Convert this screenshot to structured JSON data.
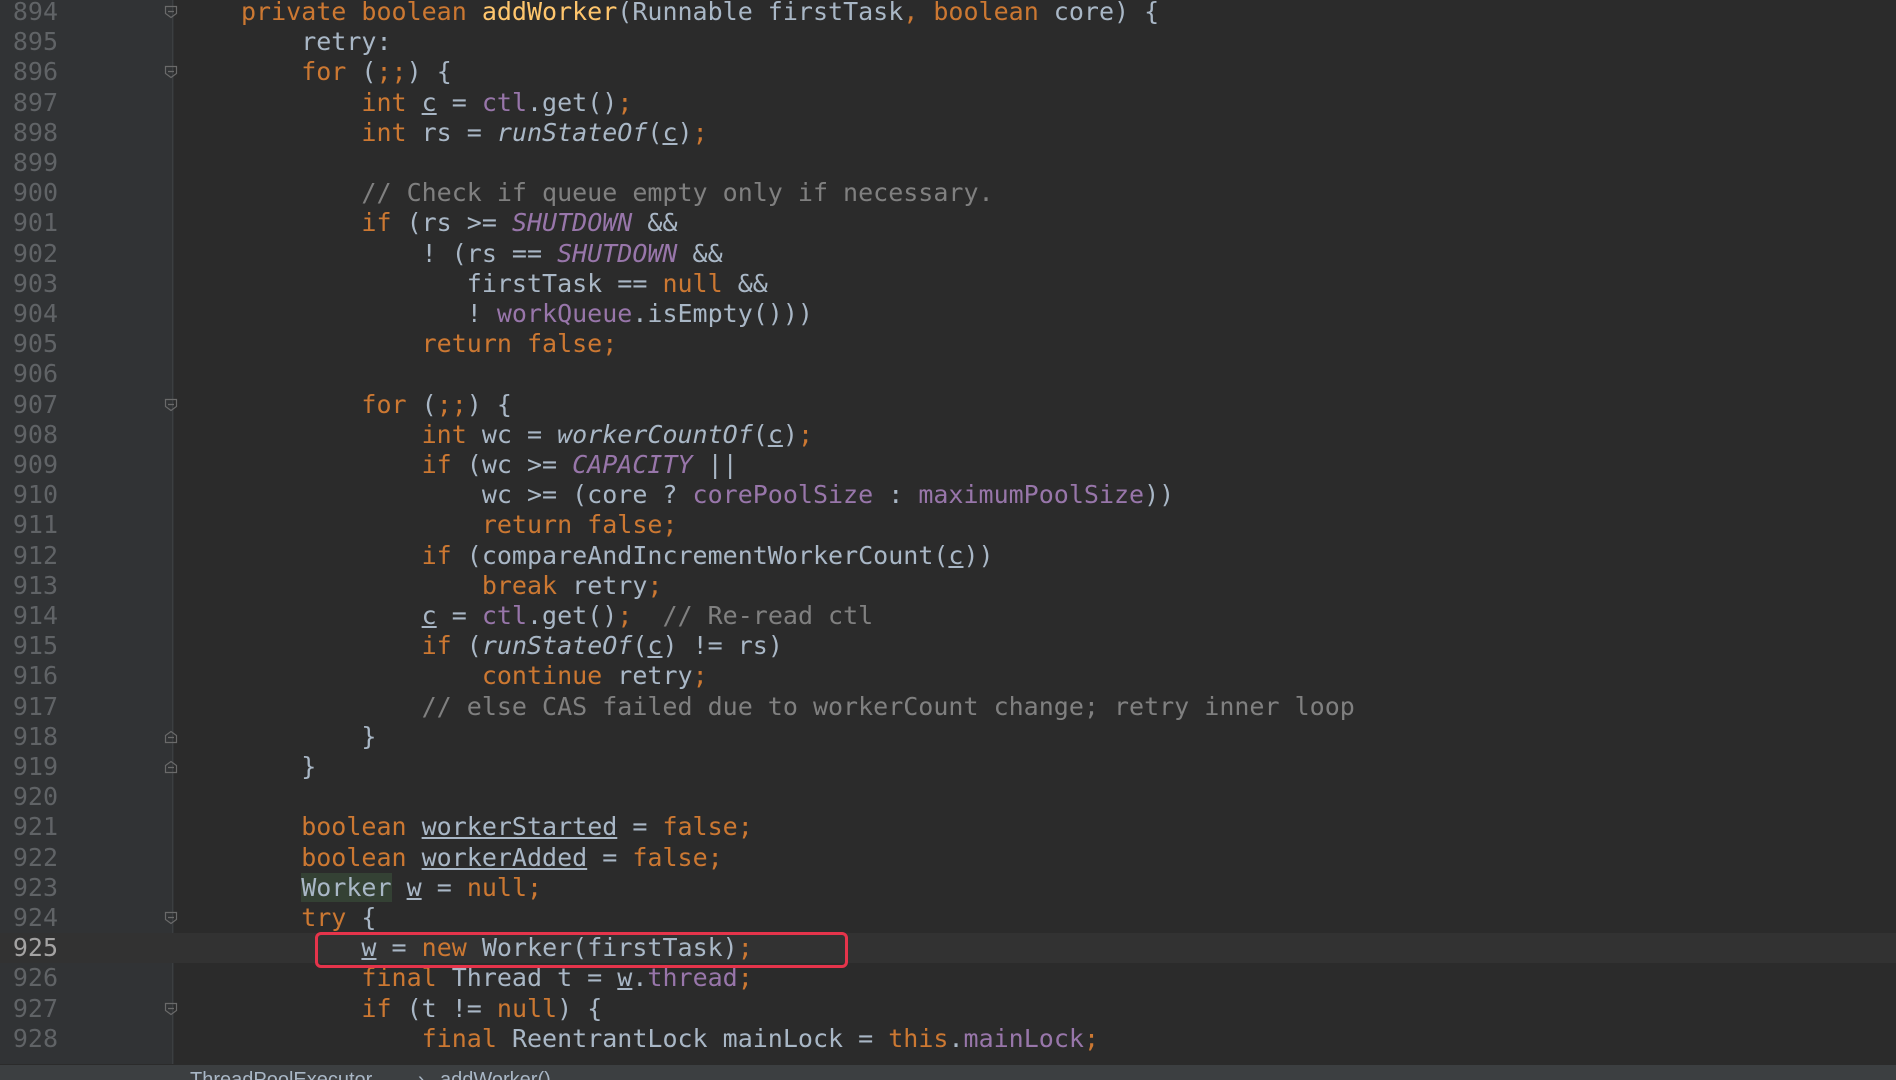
{
  "editor": {
    "current_line": "925"
  },
  "lines": [
    {
      "n": "894",
      "fold": "open",
      "code": [
        [
          "kw",
          "private boolean "
        ],
        [
          "fn",
          "addWorker"
        ],
        [
          "",
          "(Runnable firstTask"
        ],
        [
          "kw",
          ", boolean "
        ],
        [
          "",
          "core) {"
        ]
      ]
    },
    {
      "n": "895",
      "fold": "",
      "code": [
        [
          "",
          "    retry:"
        ]
      ]
    },
    {
      "n": "896",
      "fold": "open",
      "code": [
        [
          "kw",
          "    for "
        ],
        [
          "",
          "("
        ],
        [
          "kw",
          ";;"
        ],
        [
          "",
          ") {"
        ]
      ]
    },
    {
      "n": "897",
      "fold": "",
      "code": [
        [
          "kw",
          "        int "
        ],
        [
          "ul",
          "c"
        ],
        [
          "",
          " = "
        ],
        [
          "fld",
          "ctl"
        ],
        [
          "",
          ".get()"
        ],
        [
          "kw",
          ";"
        ]
      ]
    },
    {
      "n": "898",
      "fold": "",
      "code": [
        [
          "kw",
          "        int "
        ],
        [
          "",
          "rs = "
        ],
        [
          "sfn",
          "runStateOf"
        ],
        [
          "",
          "("
        ],
        [
          "ul",
          "c"
        ],
        [
          "",
          ")"
        ],
        [
          "kw",
          ";"
        ]
      ]
    },
    {
      "n": "899",
      "fold": "",
      "code": [
        [
          "",
          ""
        ]
      ]
    },
    {
      "n": "900",
      "fold": "",
      "code": [
        [
          "cmt",
          "        // Check if queue empty only if necessary."
        ]
      ]
    },
    {
      "n": "901",
      "fold": "",
      "code": [
        [
          "kw",
          "        if "
        ],
        [
          "",
          "(rs >= "
        ],
        [
          "cst",
          "SHUTDOWN"
        ],
        [
          "",
          " &&"
        ]
      ]
    },
    {
      "n": "902",
      "fold": "",
      "code": [
        [
          "",
          "            ! (rs == "
        ],
        [
          "cst",
          "SHUTDOWN"
        ],
        [
          "",
          " &&"
        ]
      ]
    },
    {
      "n": "903",
      "fold": "",
      "code": [
        [
          "",
          "               firstTask == "
        ],
        [
          "kw",
          "null "
        ],
        [
          "",
          "&&"
        ]
      ]
    },
    {
      "n": "904",
      "fold": "",
      "code": [
        [
          "",
          "               ! "
        ],
        [
          "fld",
          "workQueue"
        ],
        [
          "",
          ".isEmpty()))"
        ]
      ]
    },
    {
      "n": "905",
      "fold": "",
      "code": [
        [
          "kw",
          "            return false;"
        ]
      ]
    },
    {
      "n": "906",
      "fold": "",
      "code": [
        [
          "",
          ""
        ]
      ]
    },
    {
      "n": "907",
      "fold": "open",
      "code": [
        [
          "kw",
          "        for "
        ],
        [
          "",
          "("
        ],
        [
          "kw",
          ";;"
        ],
        [
          "",
          ") {"
        ]
      ]
    },
    {
      "n": "908",
      "fold": "",
      "code": [
        [
          "kw",
          "            int "
        ],
        [
          "",
          "wc = "
        ],
        [
          "sfn",
          "workerCountOf"
        ],
        [
          "",
          "("
        ],
        [
          "ul",
          "c"
        ],
        [
          "",
          ")"
        ],
        [
          "kw",
          ";"
        ]
      ]
    },
    {
      "n": "909",
      "fold": "",
      "code": [
        [
          "kw",
          "            if "
        ],
        [
          "",
          "(wc >= "
        ],
        [
          "cst",
          "CAPACITY"
        ],
        [
          "",
          " ||"
        ]
      ]
    },
    {
      "n": "910",
      "fold": "",
      "code": [
        [
          "",
          "                wc >= (core ? "
        ],
        [
          "fld",
          "corePoolSize"
        ],
        [
          "",
          " : "
        ],
        [
          "fld",
          "maximumPoolSize"
        ],
        [
          "",
          "))"
        ]
      ]
    },
    {
      "n": "911",
      "fold": "",
      "code": [
        [
          "kw",
          "                return false;"
        ]
      ]
    },
    {
      "n": "912",
      "fold": "",
      "code": [
        [
          "kw",
          "            if "
        ],
        [
          "",
          "(compareAndIncrementWorkerCount("
        ],
        [
          "ul",
          "c"
        ],
        [
          "",
          "))"
        ]
      ]
    },
    {
      "n": "913",
      "fold": "",
      "code": [
        [
          "kw",
          "                break "
        ],
        [
          "",
          "retry"
        ],
        [
          "kw",
          ";"
        ]
      ]
    },
    {
      "n": "914",
      "fold": "",
      "code": [
        [
          "",
          "            "
        ],
        [
          "ul",
          "c"
        ],
        [
          "",
          " = "
        ],
        [
          "fld",
          "ctl"
        ],
        [
          "",
          ".get()"
        ],
        [
          "kw",
          ";"
        ],
        [
          "cmt",
          "  // Re-read ctl"
        ]
      ]
    },
    {
      "n": "915",
      "fold": "",
      "code": [
        [
          "kw",
          "            if "
        ],
        [
          "",
          "("
        ],
        [
          "sfn",
          "runStateOf"
        ],
        [
          "",
          "("
        ],
        [
          "ul",
          "c"
        ],
        [
          "",
          ") != rs)"
        ]
      ]
    },
    {
      "n": "916",
      "fold": "",
      "code": [
        [
          "kw",
          "                continue "
        ],
        [
          "",
          "retry"
        ],
        [
          "kw",
          ";"
        ]
      ]
    },
    {
      "n": "917",
      "fold": "",
      "code": [
        [
          "cmt",
          "            // else CAS failed due to workerCount change; retry inner loop"
        ]
      ]
    },
    {
      "n": "918",
      "fold": "close",
      "code": [
        [
          "",
          "        }"
        ]
      ]
    },
    {
      "n": "919",
      "fold": "close",
      "code": [
        [
          "",
          "    }"
        ]
      ]
    },
    {
      "n": "920",
      "fold": "",
      "code": [
        [
          "",
          ""
        ]
      ]
    },
    {
      "n": "921",
      "fold": "",
      "code": [
        [
          "kw",
          "    boolean "
        ],
        [
          "ul",
          "workerStarted"
        ],
        [
          "",
          " = "
        ],
        [
          "kw",
          "false;"
        ]
      ]
    },
    {
      "n": "922",
      "fold": "",
      "code": [
        [
          "kw",
          "    boolean "
        ],
        [
          "ul",
          "workerAdded"
        ],
        [
          "",
          " = "
        ],
        [
          "kw",
          "false;"
        ]
      ]
    },
    {
      "n": "923",
      "fold": "",
      "code": [
        [
          "",
          "    "
        ],
        [
          "hl",
          "Worker"
        ],
        [
          "",
          " "
        ],
        [
          "ul",
          "w"
        ],
        [
          "",
          " = "
        ],
        [
          "kw",
          "null;"
        ]
      ]
    },
    {
      "n": "924",
      "fold": "open",
      "code": [
        [
          "kw",
          "    try "
        ],
        [
          "",
          "{"
        ]
      ]
    },
    {
      "n": "925",
      "fold": "",
      "code": [
        [
          "",
          "        "
        ],
        [
          "ul",
          "w"
        ],
        [
          "",
          " = "
        ],
        [
          "kw",
          "new "
        ],
        [
          "",
          "Worker(firstTask)"
        ],
        [
          "kw",
          ";"
        ]
      ]
    },
    {
      "n": "926",
      "fold": "",
      "code": [
        [
          "kw",
          "        final "
        ],
        [
          "",
          "Thread t = "
        ],
        [
          "ul",
          "w"
        ],
        [
          "",
          "."
        ],
        [
          "fld",
          "thread"
        ],
        [
          "kw",
          ";"
        ]
      ]
    },
    {
      "n": "927",
      "fold": "open",
      "code": [
        [
          "kw",
          "        if "
        ],
        [
          "",
          "(t != "
        ],
        [
          "kw",
          "null"
        ],
        [
          "",
          ") {"
        ]
      ]
    },
    {
      "n": "928",
      "fold": "",
      "code": [
        [
          "kw",
          "            final "
        ],
        [
          "",
          "ReentrantLock mainLock = "
        ],
        [
          "kw",
          "this"
        ],
        [
          "",
          "."
        ],
        [
          "fld",
          "mainLock"
        ],
        [
          "kw",
          ";"
        ]
      ]
    }
  ],
  "breadcrumb": {
    "class_name": "ThreadPoolExecutor",
    "separator": "›",
    "method_name": "addWorker()"
  },
  "colors": {
    "background": "#2b2b2b",
    "keyword": "#cc7832",
    "method_decl": "#ffc66d",
    "field": "#9876aa",
    "comment": "#808080",
    "text": "#a9b7c6",
    "highlight_box": "#e5344b"
  }
}
